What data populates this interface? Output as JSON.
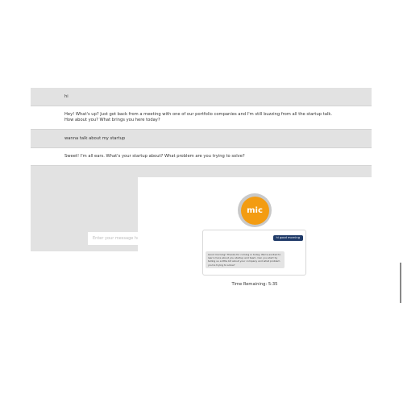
{
  "chat": {
    "messages": [
      {
        "role": "user",
        "text": "hi"
      },
      {
        "role": "assistant",
        "text": "Hey! What's up? Just got back from a meeting with one of our portfolio companies and I'm still buzzing from all the startup talk. How about you? What brings you here today?"
      },
      {
        "role": "user",
        "text": "wanna talk about my startup"
      },
      {
        "role": "assistant",
        "text": "Sweet! I'm all ears. What's your startup about? What problem are you trying to solve?"
      }
    ],
    "input_placeholder": "Enter your message he"
  },
  "voice": {
    "mic_label": "mic",
    "user_message": "hi good morning",
    "assistant_message": "Good morning! Thanks for coming in today. We're excited to learn more about you startup and team. Can you start by telling us a little bit about your company and what problem you're trying to solve?",
    "timer_text": "Time Remaining: 5:35"
  },
  "colors": {
    "chat_user_row": "#e2e2e2",
    "chat_bot_row": "#ffffff",
    "mic_orange": "#f39c12",
    "mic_ring": "#c9c9c9",
    "user_bubble": "#1f3a68",
    "bot_bubble": "#e4e4e4"
  }
}
